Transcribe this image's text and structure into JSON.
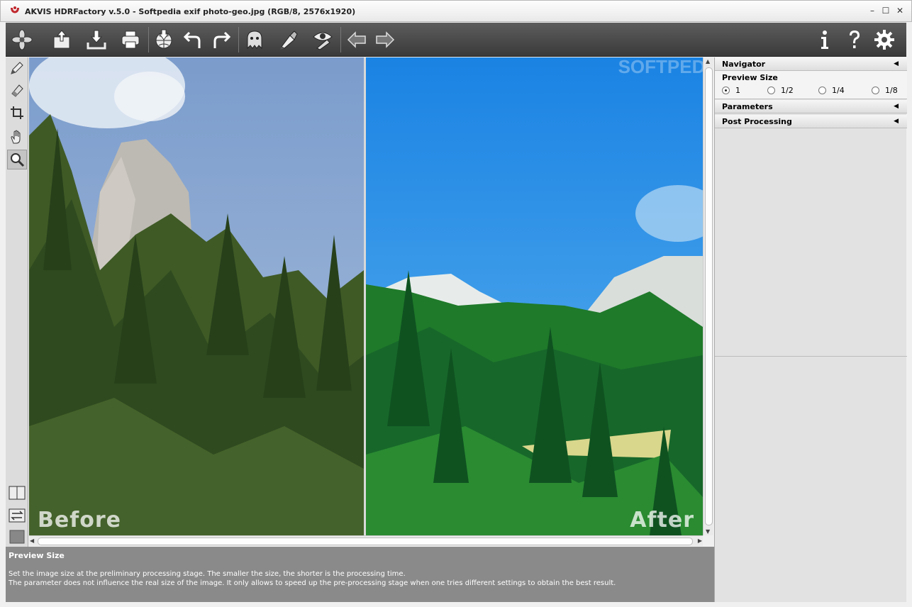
{
  "window": {
    "title": "AKVIS HDRFactory v.5.0 - Softpedia exif photo-geo.jpg (RGB/8, 2576x1920)",
    "minimize_glyph": "–",
    "maximize_glyph": "☐",
    "close_glyph": "✕"
  },
  "toolbar": {
    "buttons": [
      {
        "name": "logo-icon"
      },
      {
        "name": "open-image-icon"
      },
      {
        "name": "save-image-icon"
      },
      {
        "name": "print-icon"
      },
      {
        "name": "publish-icon"
      },
      {
        "name": "undo-icon"
      },
      {
        "name": "redo-icon"
      },
      {
        "name": "ghost-removal-icon"
      },
      {
        "name": "brush-settings-icon"
      },
      {
        "name": "preview-eye-icon"
      },
      {
        "name": "back-arrow-icon"
      },
      {
        "name": "forward-arrow-icon"
      },
      {
        "name": "info-icon"
      },
      {
        "name": "help-icon"
      },
      {
        "name": "settings-gear-icon"
      }
    ]
  },
  "tools": [
    {
      "name": "pencil-tool-icon"
    },
    {
      "name": "eraser-tool-icon"
    },
    {
      "name": "crop-tool-icon"
    },
    {
      "name": "hand-tool-icon"
    },
    {
      "name": "zoom-tool-icon"
    }
  ],
  "canvas": {
    "before_label": "Before",
    "after_label": "After",
    "watermark": "SOFTPEDIA"
  },
  "navigator": {
    "title": "Navigator",
    "preview_size_label": "Preview Size",
    "options": [
      "1",
      "1/2",
      "1/4",
      "1/8"
    ],
    "selected": "1"
  },
  "sections": {
    "parameters": "Parameters",
    "post_processing": "Post Processing"
  },
  "hint": {
    "title": "Preview Size",
    "line1": "Set the image size at the preliminary processing stage. The smaller the size, the shorter is the processing time.",
    "line2": "The parameter does not influence the real size of the image. It only allows to speed up the pre-processing stage when one tries different settings to obtain the best result."
  },
  "colors": {
    "toolbar_dark": "#4a4a4a",
    "sky_before": "#7d9ecf",
    "sky_after": "#1f8ae6",
    "forest_before": "#3f5a25",
    "forest_after": "#1f7a2a"
  }
}
